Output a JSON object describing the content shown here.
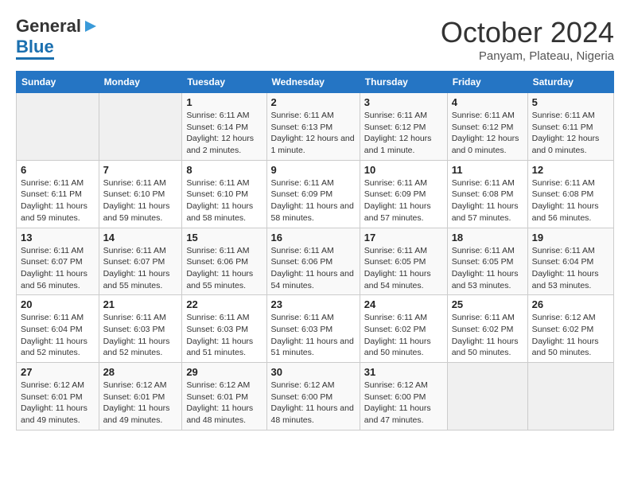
{
  "logo": {
    "general": "General",
    "blue": "Blue"
  },
  "title": {
    "month": "October 2024",
    "location": "Panyam, Plateau, Nigeria"
  },
  "headers": [
    "Sunday",
    "Monday",
    "Tuesday",
    "Wednesday",
    "Thursday",
    "Friday",
    "Saturday"
  ],
  "weeks": [
    [
      {
        "day": "",
        "sunrise": "",
        "sunset": "",
        "daylight": ""
      },
      {
        "day": "",
        "sunrise": "",
        "sunset": "",
        "daylight": ""
      },
      {
        "day": "1",
        "sunrise": "Sunrise: 6:11 AM",
        "sunset": "Sunset: 6:14 PM",
        "daylight": "Daylight: 12 hours and 2 minutes."
      },
      {
        "day": "2",
        "sunrise": "Sunrise: 6:11 AM",
        "sunset": "Sunset: 6:13 PM",
        "daylight": "Daylight: 12 hours and 1 minute."
      },
      {
        "day": "3",
        "sunrise": "Sunrise: 6:11 AM",
        "sunset": "Sunset: 6:12 PM",
        "daylight": "Daylight: 12 hours and 1 minute."
      },
      {
        "day": "4",
        "sunrise": "Sunrise: 6:11 AM",
        "sunset": "Sunset: 6:12 PM",
        "daylight": "Daylight: 12 hours and 0 minutes."
      },
      {
        "day": "5",
        "sunrise": "Sunrise: 6:11 AM",
        "sunset": "Sunset: 6:11 PM",
        "daylight": "Daylight: 12 hours and 0 minutes."
      }
    ],
    [
      {
        "day": "6",
        "sunrise": "Sunrise: 6:11 AM",
        "sunset": "Sunset: 6:11 PM",
        "daylight": "Daylight: 11 hours and 59 minutes."
      },
      {
        "day": "7",
        "sunrise": "Sunrise: 6:11 AM",
        "sunset": "Sunset: 6:10 PM",
        "daylight": "Daylight: 11 hours and 59 minutes."
      },
      {
        "day": "8",
        "sunrise": "Sunrise: 6:11 AM",
        "sunset": "Sunset: 6:10 PM",
        "daylight": "Daylight: 11 hours and 58 minutes."
      },
      {
        "day": "9",
        "sunrise": "Sunrise: 6:11 AM",
        "sunset": "Sunset: 6:09 PM",
        "daylight": "Daylight: 11 hours and 58 minutes."
      },
      {
        "day": "10",
        "sunrise": "Sunrise: 6:11 AM",
        "sunset": "Sunset: 6:09 PM",
        "daylight": "Daylight: 11 hours and 57 minutes."
      },
      {
        "day": "11",
        "sunrise": "Sunrise: 6:11 AM",
        "sunset": "Sunset: 6:08 PM",
        "daylight": "Daylight: 11 hours and 57 minutes."
      },
      {
        "day": "12",
        "sunrise": "Sunrise: 6:11 AM",
        "sunset": "Sunset: 6:08 PM",
        "daylight": "Daylight: 11 hours and 56 minutes."
      }
    ],
    [
      {
        "day": "13",
        "sunrise": "Sunrise: 6:11 AM",
        "sunset": "Sunset: 6:07 PM",
        "daylight": "Daylight: 11 hours and 56 minutes."
      },
      {
        "day": "14",
        "sunrise": "Sunrise: 6:11 AM",
        "sunset": "Sunset: 6:07 PM",
        "daylight": "Daylight: 11 hours and 55 minutes."
      },
      {
        "day": "15",
        "sunrise": "Sunrise: 6:11 AM",
        "sunset": "Sunset: 6:06 PM",
        "daylight": "Daylight: 11 hours and 55 minutes."
      },
      {
        "day": "16",
        "sunrise": "Sunrise: 6:11 AM",
        "sunset": "Sunset: 6:06 PM",
        "daylight": "Daylight: 11 hours and 54 minutes."
      },
      {
        "day": "17",
        "sunrise": "Sunrise: 6:11 AM",
        "sunset": "Sunset: 6:05 PM",
        "daylight": "Daylight: 11 hours and 54 minutes."
      },
      {
        "day": "18",
        "sunrise": "Sunrise: 6:11 AM",
        "sunset": "Sunset: 6:05 PM",
        "daylight": "Daylight: 11 hours and 53 minutes."
      },
      {
        "day": "19",
        "sunrise": "Sunrise: 6:11 AM",
        "sunset": "Sunset: 6:04 PM",
        "daylight": "Daylight: 11 hours and 53 minutes."
      }
    ],
    [
      {
        "day": "20",
        "sunrise": "Sunrise: 6:11 AM",
        "sunset": "Sunset: 6:04 PM",
        "daylight": "Daylight: 11 hours and 52 minutes."
      },
      {
        "day": "21",
        "sunrise": "Sunrise: 6:11 AM",
        "sunset": "Sunset: 6:03 PM",
        "daylight": "Daylight: 11 hours and 52 minutes."
      },
      {
        "day": "22",
        "sunrise": "Sunrise: 6:11 AM",
        "sunset": "Sunset: 6:03 PM",
        "daylight": "Daylight: 11 hours and 51 minutes."
      },
      {
        "day": "23",
        "sunrise": "Sunrise: 6:11 AM",
        "sunset": "Sunset: 6:03 PM",
        "daylight": "Daylight: 11 hours and 51 minutes."
      },
      {
        "day": "24",
        "sunrise": "Sunrise: 6:11 AM",
        "sunset": "Sunset: 6:02 PM",
        "daylight": "Daylight: 11 hours and 50 minutes."
      },
      {
        "day": "25",
        "sunrise": "Sunrise: 6:11 AM",
        "sunset": "Sunset: 6:02 PM",
        "daylight": "Daylight: 11 hours and 50 minutes."
      },
      {
        "day": "26",
        "sunrise": "Sunrise: 6:12 AM",
        "sunset": "Sunset: 6:02 PM",
        "daylight": "Daylight: 11 hours and 50 minutes."
      }
    ],
    [
      {
        "day": "27",
        "sunrise": "Sunrise: 6:12 AM",
        "sunset": "Sunset: 6:01 PM",
        "daylight": "Daylight: 11 hours and 49 minutes."
      },
      {
        "day": "28",
        "sunrise": "Sunrise: 6:12 AM",
        "sunset": "Sunset: 6:01 PM",
        "daylight": "Daylight: 11 hours and 49 minutes."
      },
      {
        "day": "29",
        "sunrise": "Sunrise: 6:12 AM",
        "sunset": "Sunset: 6:01 PM",
        "daylight": "Daylight: 11 hours and 48 minutes."
      },
      {
        "day": "30",
        "sunrise": "Sunrise: 6:12 AM",
        "sunset": "Sunset: 6:00 PM",
        "daylight": "Daylight: 11 hours and 48 minutes."
      },
      {
        "day": "31",
        "sunrise": "Sunrise: 6:12 AM",
        "sunset": "Sunset: 6:00 PM",
        "daylight": "Daylight: 11 hours and 47 minutes."
      },
      {
        "day": "",
        "sunrise": "",
        "sunset": "",
        "daylight": ""
      },
      {
        "day": "",
        "sunrise": "",
        "sunset": "",
        "daylight": ""
      }
    ]
  ]
}
